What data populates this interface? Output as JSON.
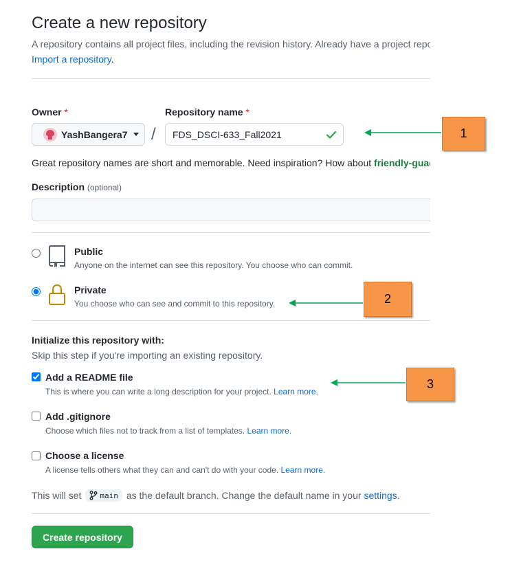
{
  "header": {
    "title": "Create a new repository",
    "subtitle": "A repository contains all project files, including the revision history. Already have a project repository elsewhere?",
    "import_link": "Import a repository",
    "import_period": "."
  },
  "owner": {
    "label": "Owner",
    "required": "*",
    "value": "YashBangera7"
  },
  "slash": "/",
  "repo_name": {
    "label": "Repository name",
    "required": "*",
    "value": "FDS_DSCI-633_Fall2021"
  },
  "hint": {
    "text": "Great repository names are short and memorable. Need inspiration? How about ",
    "suggestion": "friendly-guacamole"
  },
  "description": {
    "label": "Description",
    "optional": "(optional)",
    "value": ""
  },
  "visibility": {
    "public": {
      "title": "Public",
      "desc": "Anyone on the internet can see this repository. You choose who can commit.",
      "selected": false
    },
    "private": {
      "title": "Private",
      "desc": "You choose who can see and commit to this repository.",
      "selected": true
    }
  },
  "init": {
    "title": "Initialize this repository with:",
    "subtitle": "Skip this step if you're importing an existing repository.",
    "readme": {
      "title": "Add a README file",
      "desc": "This is where you can write a long description for your project.",
      "link": "Learn more.",
      "checked": true
    },
    "gitignore": {
      "title": "Add .gitignore",
      "desc": "Choose which files not to track from a list of templates.",
      "link": "Learn more.",
      "checked": false
    },
    "license": {
      "title": "Choose a license",
      "desc": "A license tells others what they can and can't do with your code.",
      "link": "Learn more.",
      "checked": false
    }
  },
  "branch": {
    "prefix": "This will set",
    "name": "main",
    "suffix": "as the default branch. Change the default name in your",
    "settings_link": "settings",
    "period": "."
  },
  "submit_label": "Create repository",
  "callouts": [
    "1",
    "2",
    "3"
  ],
  "colors": {
    "accent_link": "#0969da",
    "primary_button": "#2da44e",
    "success": "#1a7f37",
    "callout": "#f79646",
    "arrow": "#00a651"
  }
}
